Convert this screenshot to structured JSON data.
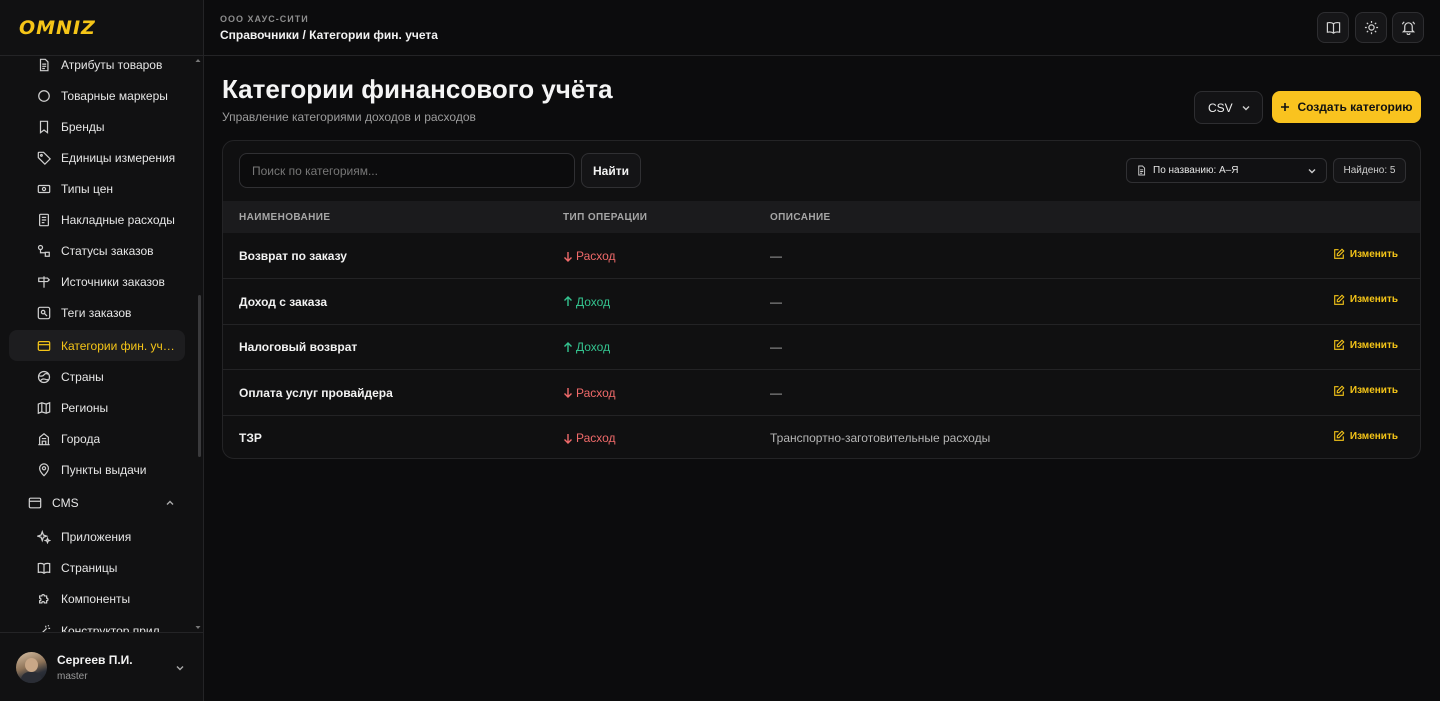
{
  "brand": {
    "logo": "OMNIZ",
    "accent": "#f9c31f"
  },
  "sidebar": {
    "items": [
      {
        "label": "Атрибуты товаров",
        "icon": "document-icon"
      },
      {
        "label": "Товарные маркеры",
        "icon": "circle-icon"
      },
      {
        "label": "Бренды",
        "icon": "bookmark-icon"
      },
      {
        "label": "Единицы измерения",
        "icon": "tag-icon"
      },
      {
        "label": "Типы цен",
        "icon": "banknote-icon"
      },
      {
        "label": "Накладные расходы",
        "icon": "receipt-icon"
      },
      {
        "label": "Статусы заказов",
        "icon": "status-icon"
      },
      {
        "label": "Источники заказов",
        "icon": "signpost-icon"
      },
      {
        "label": "Теги заказов",
        "icon": "tag-box-icon"
      },
      {
        "label": "Категории фин. учета",
        "icon": "wallet-icon",
        "active": true
      },
      {
        "label": "Страны",
        "icon": "globe-icon"
      },
      {
        "label": "Регионы",
        "icon": "map-icon"
      },
      {
        "label": "Города",
        "icon": "building-icon"
      },
      {
        "label": "Пункты выдачи",
        "icon": "pin-icon"
      }
    ],
    "cms_group": {
      "label": "CMS",
      "icon": "window-icon"
    },
    "cms_items": [
      {
        "label": "Приложения",
        "icon": "sparkles-icon"
      },
      {
        "label": "Страницы",
        "icon": "book-icon"
      },
      {
        "label": "Компоненты",
        "icon": "puzzle-icon"
      },
      {
        "label": "Конструктор прил.",
        "icon": "wand-icon"
      }
    ],
    "user": {
      "name": "Сергеев П.И.",
      "role": "master"
    }
  },
  "topbar": {
    "org": "ООО ХАУС-СИТИ",
    "breadcrumb": "Справочники / Категории фин. учета",
    "buttons": [
      "book-icon",
      "sun-icon",
      "bell-icon"
    ]
  },
  "main": {
    "title": "Категории финансового учёта",
    "subtitle": "Управление категориями доходов и расходов",
    "csv_label": "CSV",
    "create_label": "Создать категорию",
    "search_placeholder": "Поиск по категориям...",
    "find_label": "Найти",
    "sort_label": "По названию: А–Я",
    "found_label": "Найдено: 5",
    "columns": [
      "НАИМЕНОВАНИЕ",
      "ТИП ОПЕРАЦИИ",
      "ОПИСАНИЕ"
    ],
    "edit_label": "Изменить",
    "rows": [
      {
        "name": "Возврат по заказу",
        "type": "Расход",
        "kind": "expense",
        "description": "—"
      },
      {
        "name": "Доход с заказа",
        "type": "Доход",
        "kind": "income",
        "description": "—"
      },
      {
        "name": "Налоговый возврат",
        "type": "Доход",
        "kind": "income",
        "description": "—"
      },
      {
        "name": "Оплата услуг провайдера",
        "type": "Расход",
        "kind": "expense",
        "description": "—"
      },
      {
        "name": "ТЗР",
        "type": "Расход",
        "kind": "expense",
        "description": "Транспортно-заготовительные расходы"
      }
    ],
    "colors": {
      "expense": "#f06a6a",
      "income": "#34c38f"
    }
  }
}
